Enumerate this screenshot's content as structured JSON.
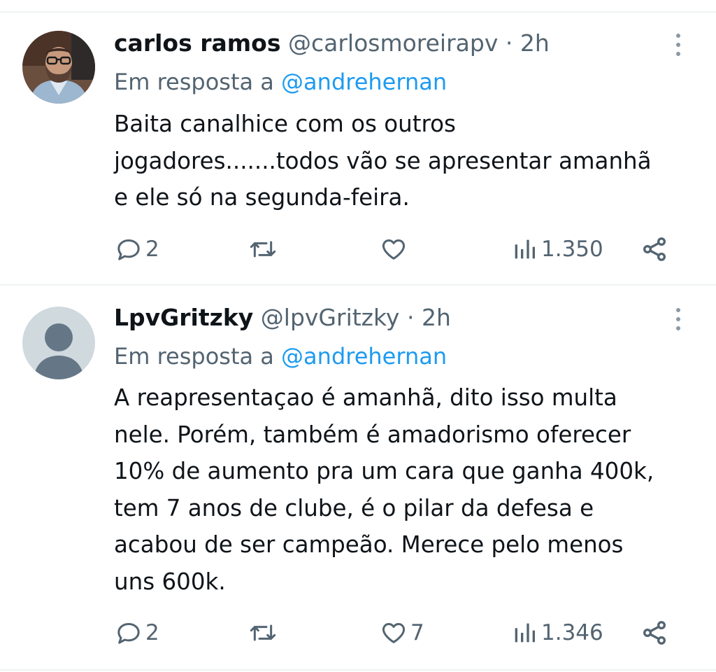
{
  "reply_prefix": "Em resposta a",
  "tweets": [
    {
      "name": "carlos ramos",
      "handle": "@carlosmoreirapv",
      "separator": "·",
      "time": "2h",
      "reply_to": "@andrehernan",
      "text_lines": [
        "Baita canalhice com os outros",
        "jogadores.......todos vão se apresentar amanhã",
        "e ele só na segunda-feira."
      ],
      "replies": "2",
      "retweets": "",
      "likes": "",
      "views": "1.350"
    },
    {
      "name": "LpvGritzky",
      "handle": "@lpvGritzky",
      "separator": "·",
      "time": "2h",
      "reply_to": "@andrehernan",
      "text_lines": [
        "A reapresentaçao é amanhã, dito isso multa",
        "nele. Porém, também é amadorismo oferecer",
        "10% de aumento pra um cara que ganha 400k,",
        "tem 7 anos de clube, é o pilar da defesa e",
        "acabou de ser campeão. Merece pelo menos",
        "uns 600k."
      ],
      "replies": "2",
      "retweets": "",
      "likes": "7",
      "views": "1.346"
    }
  ],
  "icons": {
    "reply": "reply-icon",
    "retweet": "retweet-icon",
    "like": "heart-icon",
    "views": "views-icon",
    "share": "share-icon",
    "more": "more-options-icon"
  },
  "colors": {
    "text": "#0f1419",
    "secondary": "#536471",
    "mention": "#1d9bf0",
    "divider": "#eff3f4"
  }
}
